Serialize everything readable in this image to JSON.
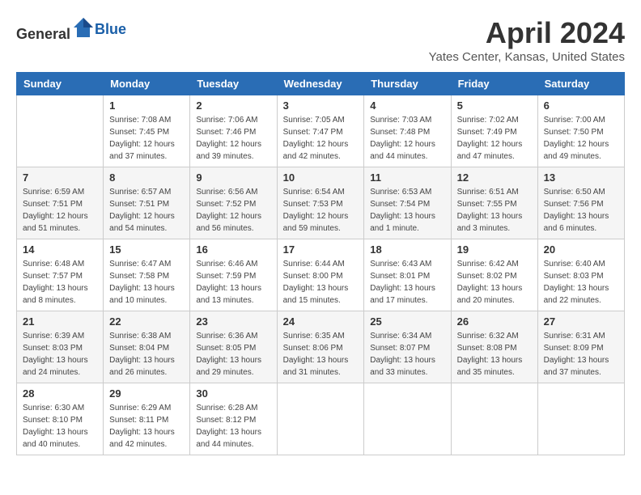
{
  "header": {
    "logo_general": "General",
    "logo_blue": "Blue",
    "month": "April 2024",
    "location": "Yates Center, Kansas, United States"
  },
  "weekdays": [
    "Sunday",
    "Monday",
    "Tuesday",
    "Wednesday",
    "Thursday",
    "Friday",
    "Saturday"
  ],
  "weeks": [
    [
      {
        "day": "",
        "sunrise": "",
        "sunset": "",
        "daylight": ""
      },
      {
        "day": "1",
        "sunrise": "Sunrise: 7:08 AM",
        "sunset": "Sunset: 7:45 PM",
        "daylight": "Daylight: 12 hours and 37 minutes."
      },
      {
        "day": "2",
        "sunrise": "Sunrise: 7:06 AM",
        "sunset": "Sunset: 7:46 PM",
        "daylight": "Daylight: 12 hours and 39 minutes."
      },
      {
        "day": "3",
        "sunrise": "Sunrise: 7:05 AM",
        "sunset": "Sunset: 7:47 PM",
        "daylight": "Daylight: 12 hours and 42 minutes."
      },
      {
        "day": "4",
        "sunrise": "Sunrise: 7:03 AM",
        "sunset": "Sunset: 7:48 PM",
        "daylight": "Daylight: 12 hours and 44 minutes."
      },
      {
        "day": "5",
        "sunrise": "Sunrise: 7:02 AM",
        "sunset": "Sunset: 7:49 PM",
        "daylight": "Daylight: 12 hours and 47 minutes."
      },
      {
        "day": "6",
        "sunrise": "Sunrise: 7:00 AM",
        "sunset": "Sunset: 7:50 PM",
        "daylight": "Daylight: 12 hours and 49 minutes."
      }
    ],
    [
      {
        "day": "7",
        "sunrise": "Sunrise: 6:59 AM",
        "sunset": "Sunset: 7:51 PM",
        "daylight": "Daylight: 12 hours and 51 minutes."
      },
      {
        "day": "8",
        "sunrise": "Sunrise: 6:57 AM",
        "sunset": "Sunset: 7:51 PM",
        "daylight": "Daylight: 12 hours and 54 minutes."
      },
      {
        "day": "9",
        "sunrise": "Sunrise: 6:56 AM",
        "sunset": "Sunset: 7:52 PM",
        "daylight": "Daylight: 12 hours and 56 minutes."
      },
      {
        "day": "10",
        "sunrise": "Sunrise: 6:54 AM",
        "sunset": "Sunset: 7:53 PM",
        "daylight": "Daylight: 12 hours and 59 minutes."
      },
      {
        "day": "11",
        "sunrise": "Sunrise: 6:53 AM",
        "sunset": "Sunset: 7:54 PM",
        "daylight": "Daylight: 13 hours and 1 minute."
      },
      {
        "day": "12",
        "sunrise": "Sunrise: 6:51 AM",
        "sunset": "Sunset: 7:55 PM",
        "daylight": "Daylight: 13 hours and 3 minutes."
      },
      {
        "day": "13",
        "sunrise": "Sunrise: 6:50 AM",
        "sunset": "Sunset: 7:56 PM",
        "daylight": "Daylight: 13 hours and 6 minutes."
      }
    ],
    [
      {
        "day": "14",
        "sunrise": "Sunrise: 6:48 AM",
        "sunset": "Sunset: 7:57 PM",
        "daylight": "Daylight: 13 hours and 8 minutes."
      },
      {
        "day": "15",
        "sunrise": "Sunrise: 6:47 AM",
        "sunset": "Sunset: 7:58 PM",
        "daylight": "Daylight: 13 hours and 10 minutes."
      },
      {
        "day": "16",
        "sunrise": "Sunrise: 6:46 AM",
        "sunset": "Sunset: 7:59 PM",
        "daylight": "Daylight: 13 hours and 13 minutes."
      },
      {
        "day": "17",
        "sunrise": "Sunrise: 6:44 AM",
        "sunset": "Sunset: 8:00 PM",
        "daylight": "Daylight: 13 hours and 15 minutes."
      },
      {
        "day": "18",
        "sunrise": "Sunrise: 6:43 AM",
        "sunset": "Sunset: 8:01 PM",
        "daylight": "Daylight: 13 hours and 17 minutes."
      },
      {
        "day": "19",
        "sunrise": "Sunrise: 6:42 AM",
        "sunset": "Sunset: 8:02 PM",
        "daylight": "Daylight: 13 hours and 20 minutes."
      },
      {
        "day": "20",
        "sunrise": "Sunrise: 6:40 AM",
        "sunset": "Sunset: 8:03 PM",
        "daylight": "Daylight: 13 hours and 22 minutes."
      }
    ],
    [
      {
        "day": "21",
        "sunrise": "Sunrise: 6:39 AM",
        "sunset": "Sunset: 8:03 PM",
        "daylight": "Daylight: 13 hours and 24 minutes."
      },
      {
        "day": "22",
        "sunrise": "Sunrise: 6:38 AM",
        "sunset": "Sunset: 8:04 PM",
        "daylight": "Daylight: 13 hours and 26 minutes."
      },
      {
        "day": "23",
        "sunrise": "Sunrise: 6:36 AM",
        "sunset": "Sunset: 8:05 PM",
        "daylight": "Daylight: 13 hours and 29 minutes."
      },
      {
        "day": "24",
        "sunrise": "Sunrise: 6:35 AM",
        "sunset": "Sunset: 8:06 PM",
        "daylight": "Daylight: 13 hours and 31 minutes."
      },
      {
        "day": "25",
        "sunrise": "Sunrise: 6:34 AM",
        "sunset": "Sunset: 8:07 PM",
        "daylight": "Daylight: 13 hours and 33 minutes."
      },
      {
        "day": "26",
        "sunrise": "Sunrise: 6:32 AM",
        "sunset": "Sunset: 8:08 PM",
        "daylight": "Daylight: 13 hours and 35 minutes."
      },
      {
        "day": "27",
        "sunrise": "Sunrise: 6:31 AM",
        "sunset": "Sunset: 8:09 PM",
        "daylight": "Daylight: 13 hours and 37 minutes."
      }
    ],
    [
      {
        "day": "28",
        "sunrise": "Sunrise: 6:30 AM",
        "sunset": "Sunset: 8:10 PM",
        "daylight": "Daylight: 13 hours and 40 minutes."
      },
      {
        "day": "29",
        "sunrise": "Sunrise: 6:29 AM",
        "sunset": "Sunset: 8:11 PM",
        "daylight": "Daylight: 13 hours and 42 minutes."
      },
      {
        "day": "30",
        "sunrise": "Sunrise: 6:28 AM",
        "sunset": "Sunset: 8:12 PM",
        "daylight": "Daylight: 13 hours and 44 minutes."
      },
      {
        "day": "",
        "sunrise": "",
        "sunset": "",
        "daylight": ""
      },
      {
        "day": "",
        "sunrise": "",
        "sunset": "",
        "daylight": ""
      },
      {
        "day": "",
        "sunrise": "",
        "sunset": "",
        "daylight": ""
      },
      {
        "day": "",
        "sunrise": "",
        "sunset": "",
        "daylight": ""
      }
    ]
  ]
}
